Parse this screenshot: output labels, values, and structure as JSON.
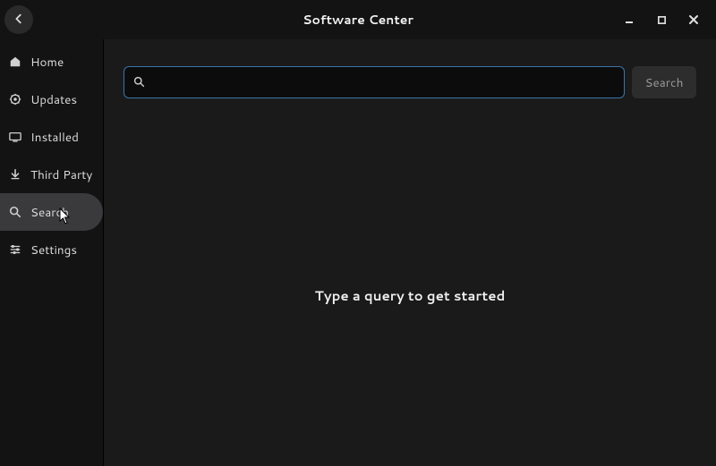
{
  "titlebar": {
    "title": "Software Center"
  },
  "sidebar": {
    "items": [
      {
        "label": "Home"
      },
      {
        "label": "Updates"
      },
      {
        "label": "Installed"
      },
      {
        "label": "Third Party"
      },
      {
        "label": "Search"
      },
      {
        "label": "Settings"
      }
    ]
  },
  "search": {
    "button_label": "Search",
    "placeholder": ""
  },
  "main": {
    "empty_state": "Type a query to get started"
  }
}
